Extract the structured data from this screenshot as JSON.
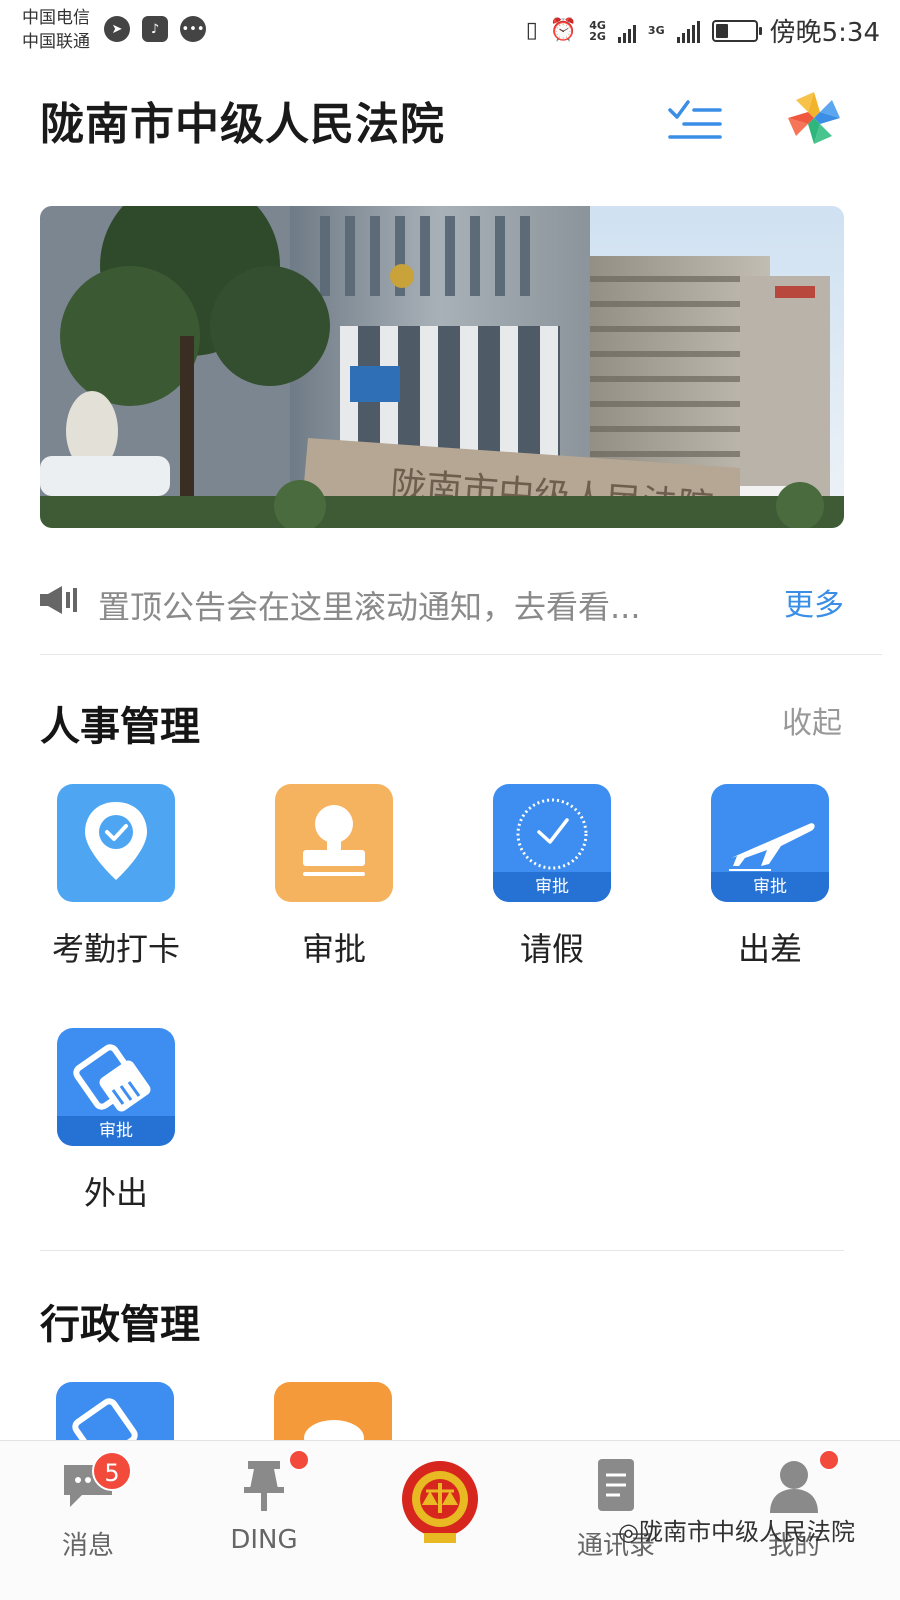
{
  "status_bar": {
    "carrier_1": "中国电信",
    "carrier_2": "中国联通",
    "network_1": "4G",
    "network_2": "2G",
    "network_3": "3G",
    "time": "傍晚5:34"
  },
  "header": {
    "title": "陇南市中级人民法院"
  },
  "banner": {
    "stone_text": "陇南市中级人民法院"
  },
  "notice": {
    "text": "置顶公告会在这里滚动通知，去看看...",
    "more_label": "更多"
  },
  "sections": {
    "hr": {
      "title": "人事管理",
      "collapse_label": "收起",
      "apps": [
        {
          "label": "考勤打卡",
          "icon": "location-check-icon",
          "color": "#4ea6f2"
        },
        {
          "label": "审批",
          "icon": "stamp-icon",
          "color": "#f5b25f"
        },
        {
          "label": "请假",
          "icon": "clock-icon",
          "color": "#3d8ef0",
          "tag": "审批"
        },
        {
          "label": "出差",
          "icon": "airplane-icon",
          "color": "#3d8ef0",
          "tag": "审批"
        },
        {
          "label": "外出",
          "icon": "handshake-icon",
          "color": "#3d8ef0",
          "tag": "审批"
        }
      ]
    },
    "admin": {
      "title": "行政管理"
    }
  },
  "bottom_nav": {
    "messages_label": "消息",
    "messages_badge": "5",
    "ding_label": "DING",
    "contacts_label": "通讯录",
    "me_label": "我的"
  },
  "watermark": "陇南市中级人民法院",
  "colors": {
    "accent": "#3a8ee6",
    "badge": "#f24b3c"
  }
}
